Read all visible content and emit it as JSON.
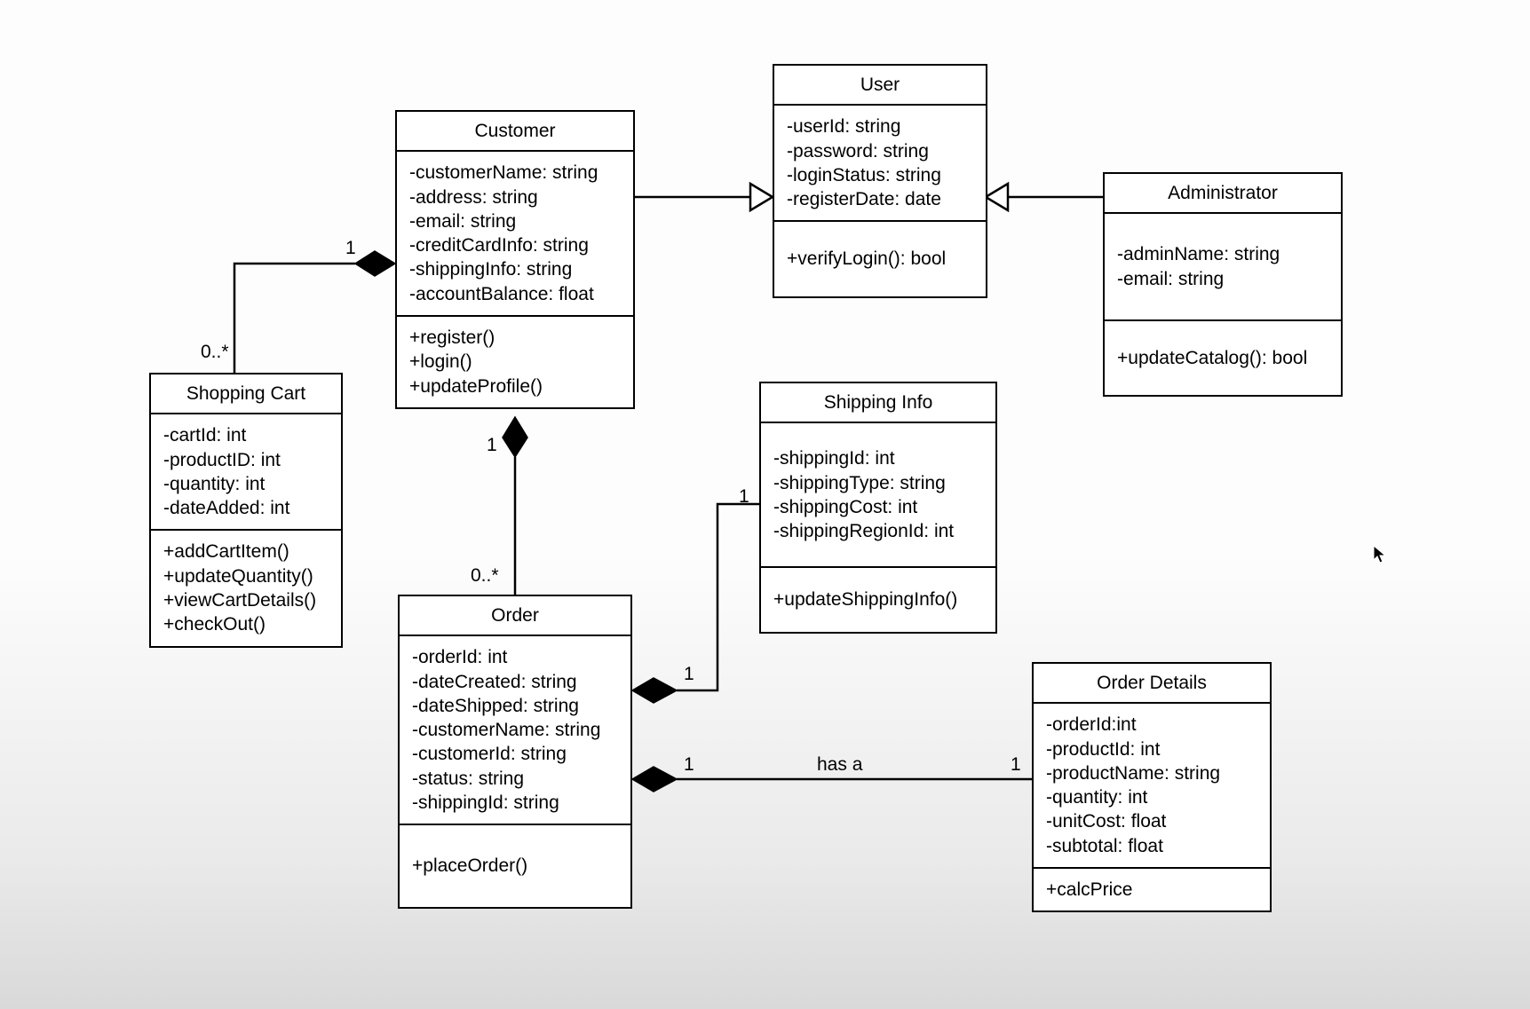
{
  "diagram_type": "UML Class Diagram",
  "classes": {
    "user": {
      "name": "User",
      "attributes": [
        "-userId: string",
        "-password: string",
        "-loginStatus: string",
        "-registerDate: date"
      ],
      "operations": [
        "+verifyLogin(): bool"
      ]
    },
    "customer": {
      "name": "Customer",
      "attributes": [
        "-customerName: string",
        "-address: string",
        "-email: string",
        "-creditCardInfo: string",
        "-shippingInfo: string",
        "-accountBalance: float"
      ],
      "operations": [
        "+register()",
        "+login()",
        "+updateProfile()"
      ]
    },
    "administrator": {
      "name": "Administrator",
      "attributes": [
        "-adminName: string",
        "-email: string"
      ],
      "operations": [
        "+updateCatalog(): bool"
      ]
    },
    "shopping_cart": {
      "name": "Shopping Cart",
      "attributes": [
        "-cartId: int",
        "-productID: int",
        "-quantity: int",
        "-dateAdded: int"
      ],
      "operations": [
        "+addCartItem()",
        "+updateQuantity()",
        "+viewCartDetails()",
        "+checkOut()"
      ]
    },
    "order": {
      "name": "Order",
      "attributes": [
        "-orderId: int",
        "-dateCreated: string",
        "-dateShipped: string",
        "-customerName: string",
        "-customerId: string",
        "-status: string",
        "-shippingId: string"
      ],
      "operations": [
        "+placeOrder()"
      ]
    },
    "shipping_info": {
      "name": "Shipping Info",
      "attributes": [
        "-shippingId: int",
        "-shippingType: string",
        "-shippingCost: int",
        "-shippingRegionId: int"
      ],
      "operations": [
        "+updateShippingInfo()"
      ]
    },
    "order_details": {
      "name": "Order Details",
      "attributes": [
        "-orderId:int",
        "-productId: int",
        "-productName: string",
        "-quantity: int",
        "-unitCost: float",
        "-subtotal: float"
      ],
      "operations": [
        "+calcPrice"
      ]
    }
  },
  "relationships": [
    {
      "from": "Customer",
      "to": "User",
      "type": "generalization"
    },
    {
      "from": "Administrator",
      "to": "User",
      "type": "generalization"
    },
    {
      "from": "Customer",
      "to": "Shopping Cart",
      "type": "composition",
      "from_mult": "1",
      "to_mult": "0..*"
    },
    {
      "from": "Customer",
      "to": "Order",
      "type": "composition",
      "from_mult": "1",
      "to_mult": "0..*"
    },
    {
      "from": "Order",
      "to": "Shipping Info",
      "type": "composition",
      "from_mult": "1",
      "to_mult": "1"
    },
    {
      "from": "Order",
      "to": "Order Details",
      "type": "composition",
      "from_mult": "1",
      "to_mult": "1",
      "label": "has a"
    }
  ],
  "labels": {
    "mult_customer_cart_1": "1",
    "mult_customer_cart_many": "0..*",
    "mult_customer_order_1": "1",
    "mult_customer_order_many": "0..*",
    "mult_order_shipping_1a": "1",
    "mult_order_shipping_1b": "1",
    "mult_order_details_1a": "1",
    "mult_order_details_1b": "1",
    "rel_has_a": "has a"
  }
}
